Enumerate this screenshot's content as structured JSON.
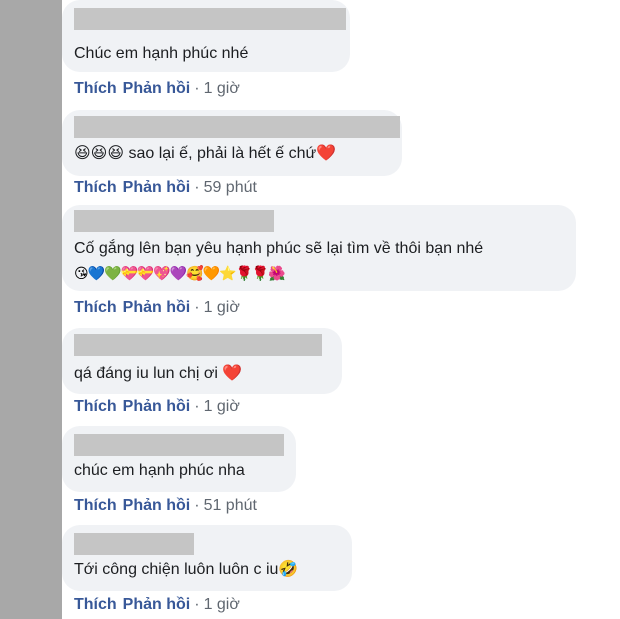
{
  "comments": [
    {
      "text": "Chúc em hạnh phúc nhé",
      "emojis": "",
      "like": "Thích",
      "reply": "Phản hồi",
      "dot": "·",
      "time": "1 giờ"
    },
    {
      "text": "😆😆😆 sao lại ế, phải là hết ế chứ❤️",
      "emojis": "",
      "like": "Thích",
      "reply": "Phản hồi",
      "dot": "·",
      "time": "59 phút"
    },
    {
      "text": "Cố gắng lên bạn yêu hạnh phúc sẽ lại tìm về thôi bạn nhé",
      "emojis": "😘💙💚💝💝💖💜🥰🧡⭐🌹🌹🌺",
      "like": "Thích",
      "reply": "Phản hồi",
      "dot": "·",
      "time": "1 giờ"
    },
    {
      "text": "qá đáng iu lun chị ơi ❤️",
      "emojis": "",
      "like": "Thích",
      "reply": "Phản hồi",
      "dot": "·",
      "time": "1 giờ"
    },
    {
      "text": "chúc em hạnh phúc nha",
      "emojis": "",
      "like": "Thích",
      "reply": "Phản hồi",
      "dot": "·",
      "time": "51 phút"
    },
    {
      "text": "Tới công chiện luôn luôn c iu🤣",
      "emojis": "",
      "like": "Thích",
      "reply": "Phản hồi",
      "dot": "·",
      "time": "1 giờ"
    }
  ]
}
